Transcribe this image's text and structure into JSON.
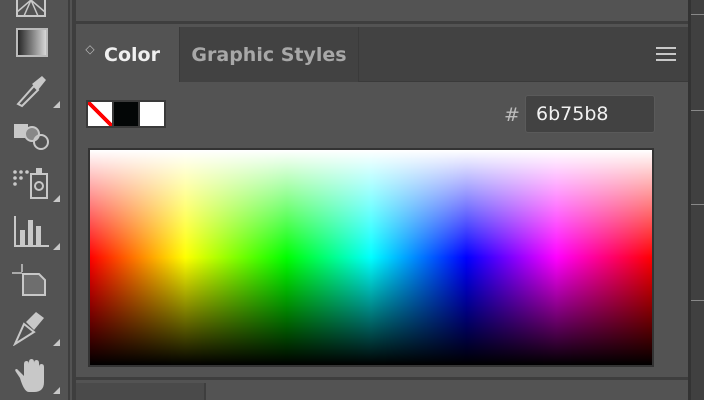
{
  "tabs": [
    {
      "label": "Color",
      "active": true
    },
    {
      "label": "Graphic Styles",
      "active": false
    }
  ],
  "color_panel": {
    "hex_prefix": "#",
    "hex_value": "6b75b8",
    "swatches": [
      {
        "name": "none",
        "color": "#ffffff"
      },
      {
        "name": "black",
        "color": "#030606"
      },
      {
        "name": "white",
        "color": "#ffffff"
      }
    ]
  },
  "tools": [
    "mesh-tool",
    "gradient-tool",
    "eyedropper-tool",
    "shape-builder-tool",
    "symbol-sprayer-tool",
    "graph-tool",
    "artboard-tool",
    "pen-tool",
    "hand-tool"
  ],
  "colors": {
    "panel_bg": "#535353",
    "tab_bar_bg": "#424242",
    "divider": "#3e3e3e"
  }
}
